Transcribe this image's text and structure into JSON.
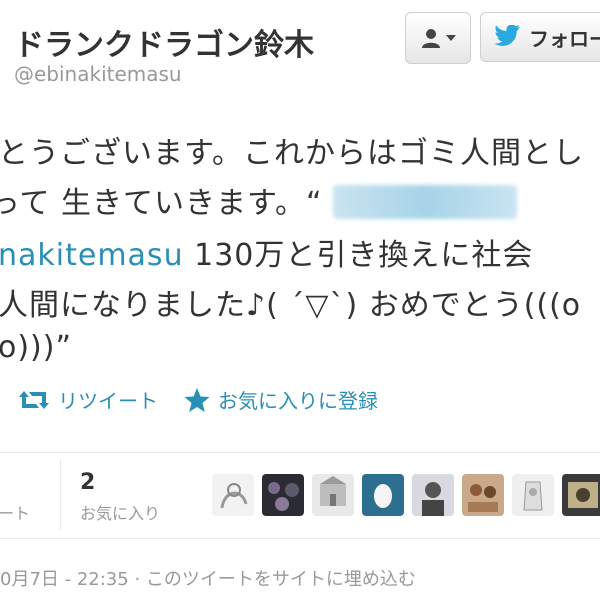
{
  "header": {
    "name": "ドランクドラゴン鈴木",
    "handle": "@ebinakitemasu",
    "follow_label": "フォロー"
  },
  "tweet": {
    "line1": "とうございます。これからはゴミ人間とし",
    "line2": "って 生きていきます。“",
    "line3_mention": "nakitemasu",
    "line3_rest": " 130万と引き換えに社会",
    "line4": "人間になりました♪( ´▽`) おめでとう(((o",
    "line5": "o)))”"
  },
  "actions": {
    "retweet_label": "リツイート",
    "favorite_label": "お気に入りに登録"
  },
  "stats": {
    "retweets_label": "ート",
    "favorites_count": "2",
    "favorites_label": "お気に入り"
  },
  "footer": {
    "date": "0月7日 - 22:35",
    "separator": " · ",
    "embed_label": "このツイートをサイトに埋め込む"
  },
  "colors": {
    "link": "#2a8fb4",
    "twitter_bird": "#2aa9e0",
    "muted": "#999999"
  }
}
